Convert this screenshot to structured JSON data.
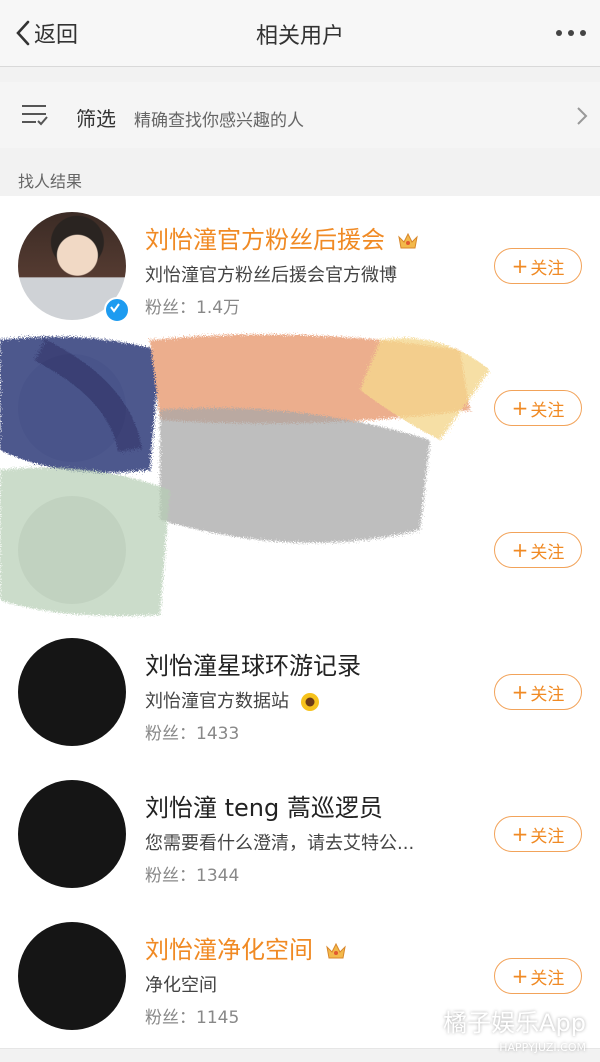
{
  "nav": {
    "back_label": "返回",
    "title": "相关用户"
  },
  "filter": {
    "label": "筛选",
    "description": "精确查找你感兴趣的人"
  },
  "section_label": "找人结果",
  "follow_label": "关注",
  "users": [
    {
      "name": "刘怡潼官方粉丝后援会",
      "description": "刘怡潼官方粉丝后援会官方微博",
      "fans": "粉丝：1.4万"
    },
    {
      "name": "",
      "description": "",
      "fans": ""
    },
    {
      "name": "",
      "description": "",
      "fans": ""
    },
    {
      "name": "刘怡潼星球环游记录",
      "description": "刘怡潼官方数据站",
      "fans": "粉丝：1433"
    },
    {
      "name": "刘怡潼 teng 蒿巡逻员",
      "description": "您需要看什么澄清，请去艾特公...",
      "fans": "粉丝：1344"
    },
    {
      "name": "刘怡潼净化空间",
      "description": "净化空间",
      "fans": "粉丝：1145"
    }
  ],
  "watermark": {
    "main": "橘子娱乐App",
    "sub": "HAPPYJUZI.COM"
  },
  "colors": {
    "accent": "#f08a24",
    "verified": "#1d9bf0"
  }
}
